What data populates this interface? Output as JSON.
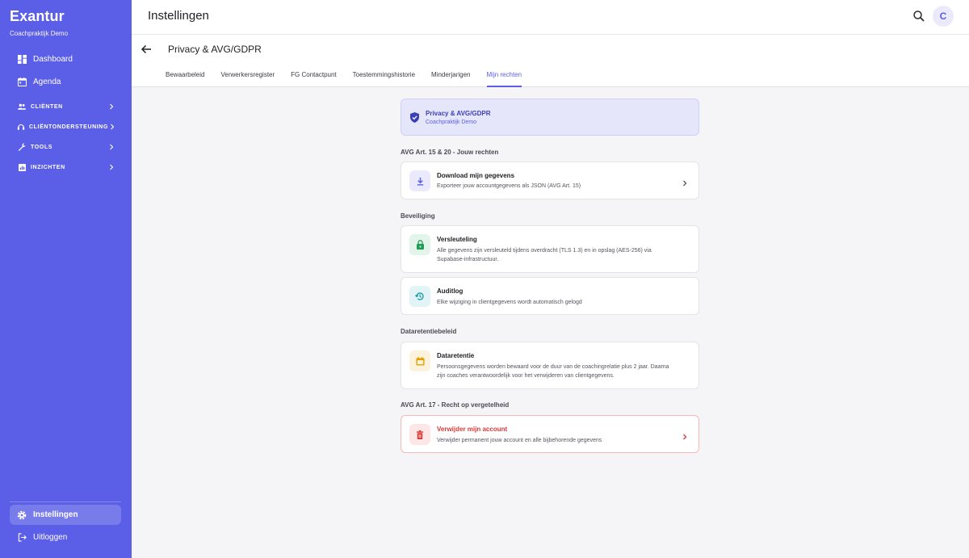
{
  "sidebar": {
    "brand": "Exantur",
    "subtitle": "Coachpraktijk Demo",
    "items": [
      {
        "label": "Dashboard",
        "icon": "dashboard-icon"
      },
      {
        "label": "Agenda",
        "icon": "calendar-icon"
      }
    ],
    "groups": [
      {
        "label": "CLIËNTEN",
        "icon": "people-icon"
      },
      {
        "label": "CLIËNTONDERSTEUNING",
        "icon": "support-icon"
      },
      {
        "label": "TOOLS",
        "icon": "wrench-icon"
      },
      {
        "label": "INZICHTEN",
        "icon": "chart-icon"
      }
    ],
    "bottom": [
      {
        "label": "Instellingen",
        "icon": "gear-icon",
        "active": true
      },
      {
        "label": "Uitloggen",
        "icon": "logout-icon"
      }
    ]
  },
  "header": {
    "title": "Instellingen",
    "avatar_initial": "C"
  },
  "subheader": {
    "title": "Privacy & AVG/GDPR",
    "tabs": [
      {
        "label": "Bewaarbeleid"
      },
      {
        "label": "Verwerkersregister"
      },
      {
        "label": "FG Contactpunt"
      },
      {
        "label": "Toestemmingshistorie"
      },
      {
        "label": "Minderjarigen"
      },
      {
        "label": "Mijn rechten",
        "active": true
      }
    ]
  },
  "banner": {
    "title": "Privacy & AVG/GDPR",
    "subtitle": "Coachpraktijk Demo"
  },
  "sections": {
    "rights_label": "AVG Art. 15 & 20 - Jouw rechten",
    "security_label": "Beveiliging",
    "retention_label": "Dataretentiebeleid",
    "forget_label": "AVG Art. 17 - Recht op vergetelheid"
  },
  "cards": {
    "download": {
      "title": "Download mijn gegevens",
      "desc": "Exporteer jouw accountgegevens als JSON (AVG Art. 15)"
    },
    "encryption": {
      "title": "Versleuteling",
      "desc": "Alle gegevens zijn versleuteld tijdens overdracht (TLS 1.3) en in opslag (AES-256) via Supabase-infrastructuur."
    },
    "audit": {
      "title": "Auditlog",
      "desc": "Elke wijziging in clientgegevens wordt automatisch gelogd"
    },
    "retention": {
      "title": "Dataretentie",
      "desc": "Persoonsgegevens worden bewaard voor de duur van de coachingrelatie plus 2 jaar. Daarna zijn coaches verantwoordelijk voor het verwijderen van clientgegevens."
    },
    "delete": {
      "title": "Verwijder mijn account",
      "desc": "Verwijder permanent jouw account en alle bijbehorende gegevens"
    }
  },
  "colors": {
    "accent": "#5b5ee6",
    "danger": "#d83a3a",
    "success": "#1f9d55",
    "warning": "#e0a100"
  }
}
